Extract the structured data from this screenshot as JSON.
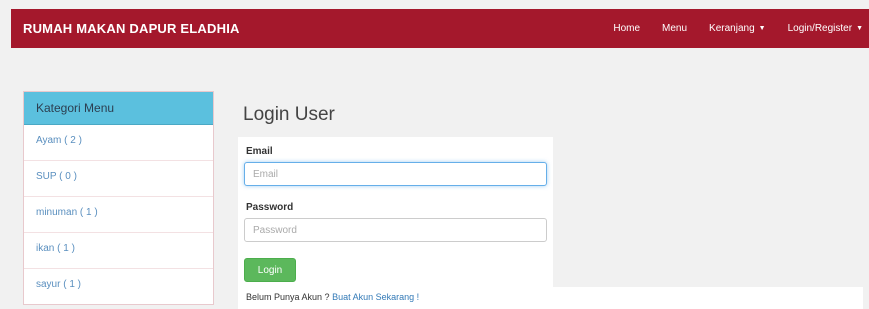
{
  "navbar": {
    "brand": "RUMAH MAKAN DAPUR ELADHIA",
    "items": [
      {
        "label": "Home",
        "dropdown": false
      },
      {
        "label": "Menu",
        "dropdown": false
      },
      {
        "label": "Keranjang",
        "dropdown": true
      },
      {
        "label": "Login/Register",
        "dropdown": true
      }
    ],
    "color": "#a4182c"
  },
  "sidebar": {
    "header": "Kategori Menu",
    "header_color": "#5bc0de",
    "items": [
      {
        "label": "Ayam ( 2 )"
      },
      {
        "label": "SUP ( 0 )"
      },
      {
        "label": "minuman ( 1 )"
      },
      {
        "label": "ikan ( 1 )"
      },
      {
        "label": "sayur ( 1 )"
      }
    ]
  },
  "login": {
    "title": "Login User",
    "email_label": "Email",
    "email_placeholder": "Email",
    "password_label": "Password",
    "password_placeholder": "Password",
    "submit_label": "Login",
    "submit_color": "#5cb85c"
  },
  "footer": {
    "prefix": "Belum Punya Akun ? ",
    "link": "Buat Akun Sekarang !"
  }
}
